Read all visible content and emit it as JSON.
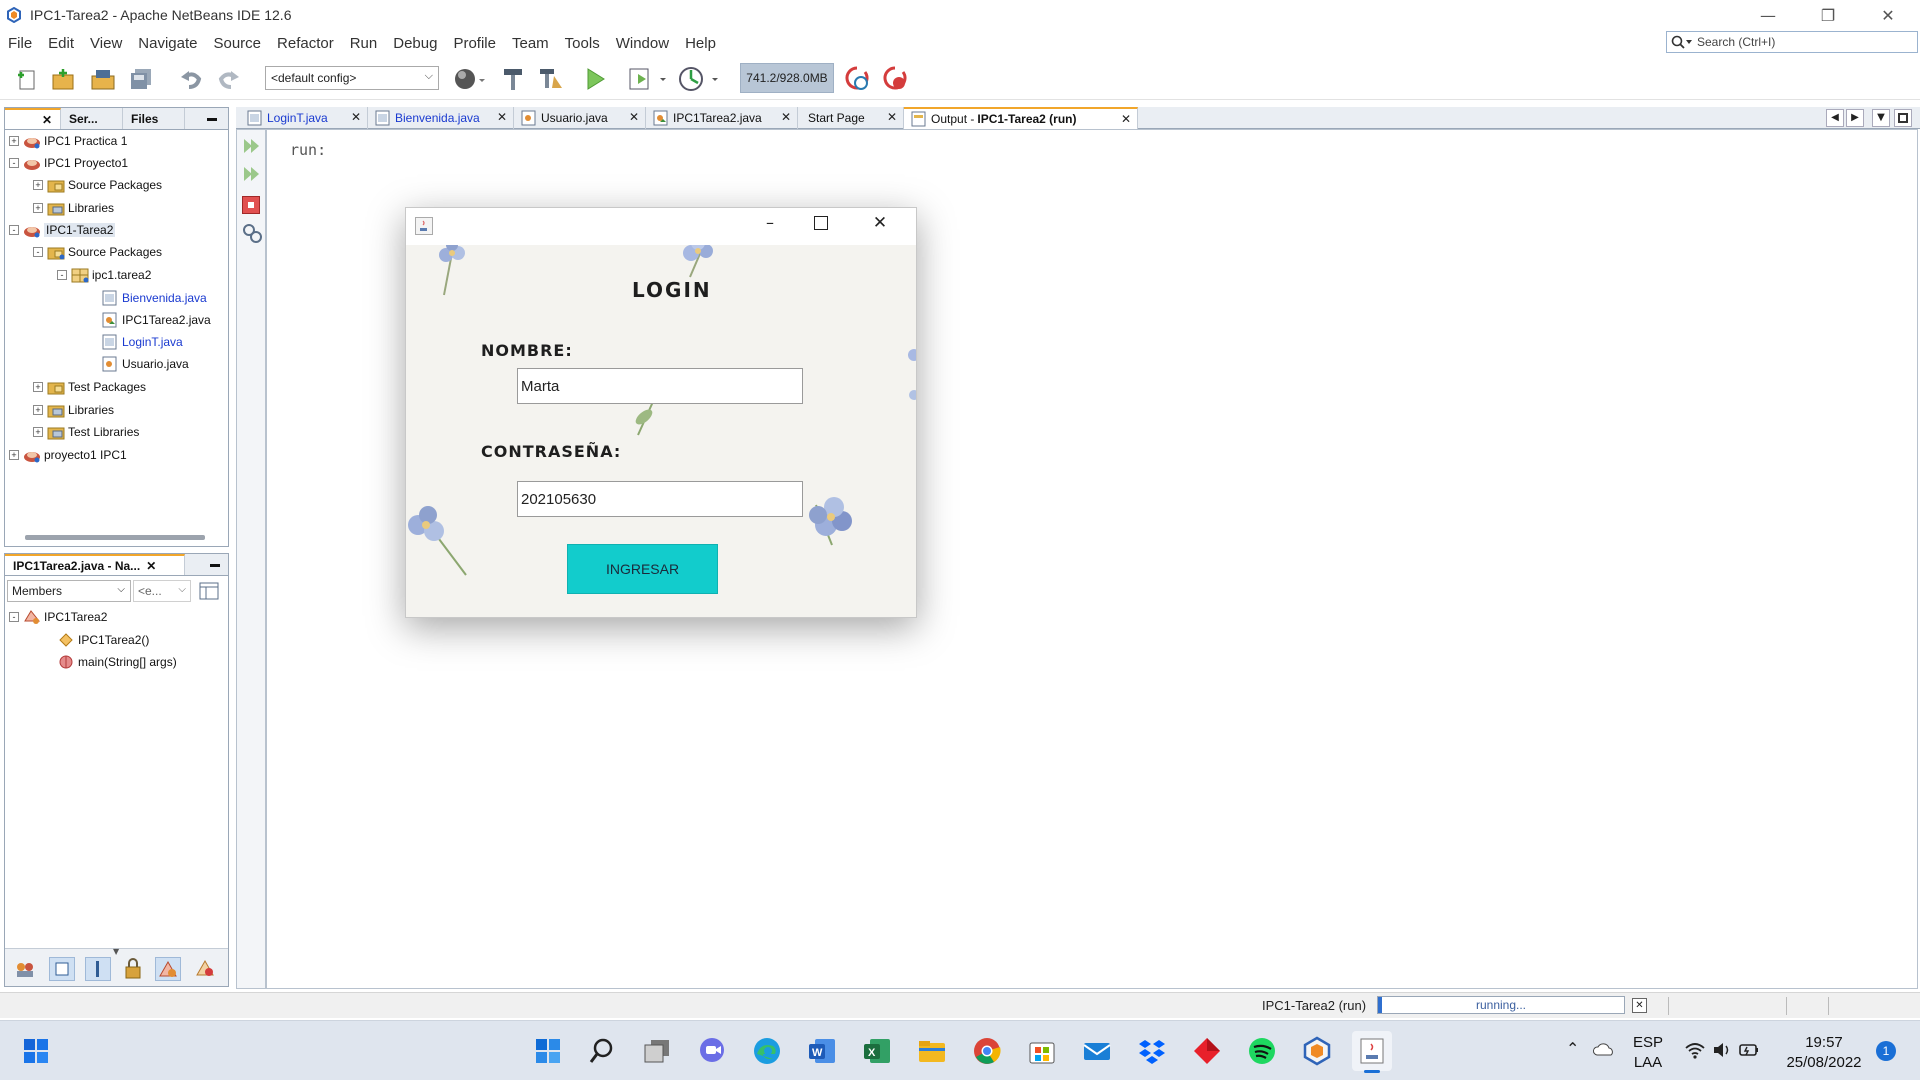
{
  "window": {
    "title": "IPC1-Tarea2 - Apache NetBeans IDE 12.6",
    "controls": [
      "minimize",
      "restore",
      "close"
    ]
  },
  "menu": [
    "File",
    "Edit",
    "View",
    "Navigate",
    "Source",
    "Refactor",
    "Run",
    "Debug",
    "Profile",
    "Team",
    "Tools",
    "Window",
    "Help"
  ],
  "search": {
    "placeholder": "Search (Ctrl+I)"
  },
  "toolbar": {
    "config": "<default config>",
    "memory": "741.2/928.0MB"
  },
  "projects_panel": {
    "tabs": [
      "",
      "Ser...",
      "Files"
    ],
    "tree": [
      {
        "label": "IPC1 Practica 1",
        "icon": "project-icon",
        "expander": "+"
      },
      {
        "label": "IPC1 Proyecto1",
        "icon": "project-icon",
        "expander": "-"
      },
      {
        "label": "Source Packages",
        "icon": "folder-package-icon",
        "expander": "+"
      },
      {
        "label": "Libraries",
        "icon": "library-icon",
        "expander": "+"
      },
      {
        "label": "IPC1-Tarea2",
        "icon": "project-icon",
        "expander": "-"
      },
      {
        "label": "Source Packages",
        "icon": "folder-package-icon",
        "expander": "-"
      },
      {
        "label": "ipc1.tarea2",
        "icon": "package-icon",
        "expander": "-"
      },
      {
        "label": "Bienvenida.java",
        "icon": "java-form-icon",
        "expander": ""
      },
      {
        "label": "IPC1Tarea2.java",
        "icon": "java-class-icon",
        "expander": ""
      },
      {
        "label": "LoginT.java",
        "icon": "java-form-icon",
        "expander": ""
      },
      {
        "label": "Usuario.java",
        "icon": "java-class-icon",
        "expander": ""
      },
      {
        "label": "Test Packages",
        "icon": "folder-package-icon",
        "expander": "+"
      },
      {
        "label": "Libraries",
        "icon": "library-icon",
        "expander": "+"
      },
      {
        "label": "Test Libraries",
        "icon": "library-icon",
        "expander": "+"
      },
      {
        "label": "proyecto1 IPC1",
        "icon": "project-icon",
        "expander": "+"
      }
    ]
  },
  "navigator_panel": {
    "tab": "IPC1Tarea2.java - Na...",
    "filter": "Members",
    "filter2": "<e...",
    "tree": [
      {
        "label": "IPC1Tarea2",
        "icon": "class-icon"
      },
      {
        "label": "IPC1Tarea2()",
        "icon": "constructor-icon"
      },
      {
        "label": "main(String[] args)",
        "icon": "method-icon"
      }
    ]
  },
  "editor_tabs": [
    {
      "label": "LoginT.java",
      "active": false
    },
    {
      "label": "Bienvenida.java",
      "active": false
    },
    {
      "label": "Usuario.java",
      "active": false
    },
    {
      "label": "IPC1Tarea2.java",
      "active": false
    },
    {
      "label": "Start Page",
      "active": false
    },
    {
      "label": "Output - ",
      "bold": "IPC1-Tarea2 (run)",
      "active": true
    }
  ],
  "output": {
    "text": "run:"
  },
  "status": {
    "task": "IPC1-Tarea2 (run)",
    "progress_text": "running..."
  },
  "dialog": {
    "title_label": "LOGIN",
    "name_label": "NOMBRE:",
    "name_value": "Marta",
    "password_label": "CONTRASEÑA:",
    "password_value": "202105630",
    "button": "INGRESAR"
  },
  "taskbar": {
    "apps": [
      "start-icon",
      "search-icon",
      "task-view-icon",
      "chat-icon",
      "edge-icon",
      "word-icon",
      "excel-icon",
      "file-explorer-icon",
      "chrome-icon",
      "store-icon",
      "mail-icon",
      "dropbox-icon",
      "app-red-icon",
      "spotify-icon",
      "netbeans-icon",
      "java-icon"
    ],
    "lang": "ESP",
    "lang2": "LAA",
    "time": "19:57",
    "date": "25/08/2022",
    "notifications": "1"
  }
}
